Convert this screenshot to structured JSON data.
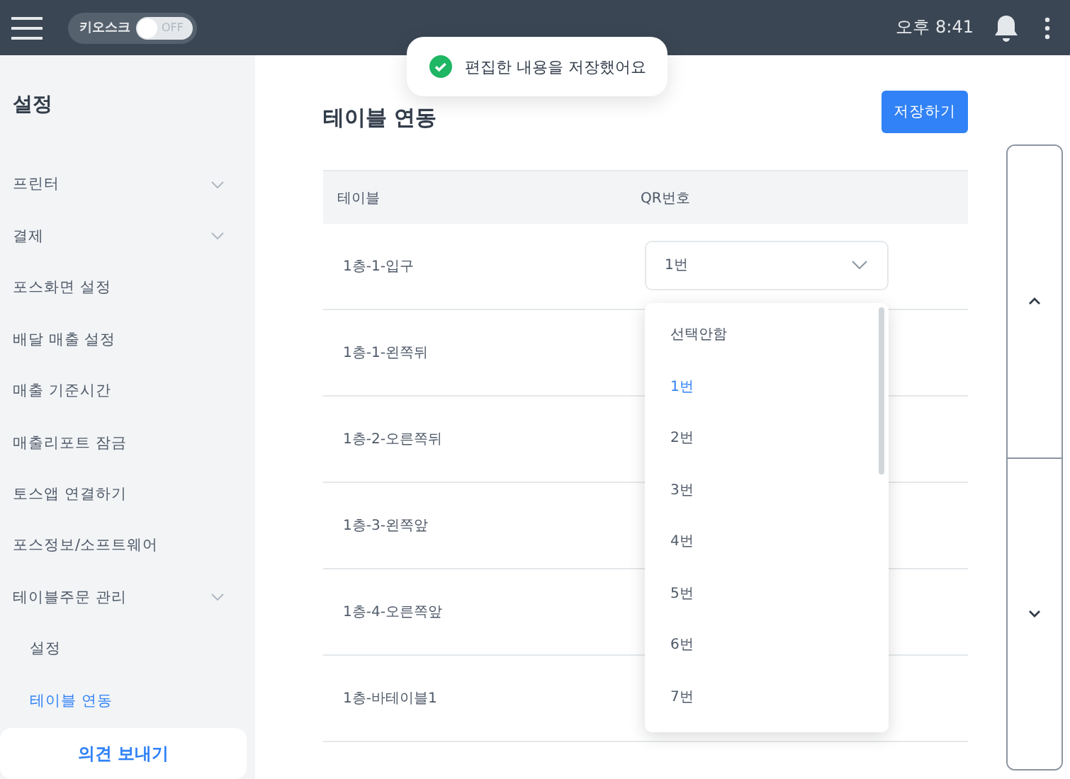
{
  "topbar": {
    "kiosk": {
      "label": "키오스크",
      "on": false,
      "state_label": "OFF"
    },
    "time": "오후 8:41"
  },
  "toast": {
    "message": "편집한 내용을 저장했어요"
  },
  "sidebar": {
    "title": "설정",
    "items": [
      {
        "label": "프린터",
        "kind": "group"
      },
      {
        "label": "결제",
        "kind": "group"
      },
      {
        "label": "포스화면 설정",
        "kind": "link"
      },
      {
        "label": "배달 매출 설정",
        "kind": "link"
      },
      {
        "label": "매출 기준시간",
        "kind": "link"
      },
      {
        "label": "매출리포트 잠금",
        "kind": "link"
      },
      {
        "label": "토스앱 연결하기",
        "kind": "link"
      },
      {
        "label": "포스정보/소프트웨어",
        "kind": "link"
      },
      {
        "label": "테이블주문 관리",
        "kind": "group",
        "children": [
          {
            "label": "설정",
            "selected": false
          },
          {
            "label": "테이블 연동",
            "selected": true
          }
        ]
      }
    ],
    "feedback_button": "의견 보내기"
  },
  "main": {
    "title": "테이블 연동",
    "save_button": "저장하기",
    "table": {
      "columns": [
        "테이블",
        "QR번호"
      ],
      "rows": [
        {
          "table": "1층-1-입구"
        },
        {
          "table": "1층-1-왼쪽뒤"
        },
        {
          "table": "1층-2-오른쪽뒤"
        },
        {
          "table": "1층-3-왼쪽앞"
        },
        {
          "table": "1층-4-오른쪽앞"
        },
        {
          "table": "1층-바테이블1"
        }
      ]
    },
    "qr_select": {
      "value": "1번",
      "options": [
        {
          "label": "선택안함",
          "selected": false
        },
        {
          "label": "1번",
          "selected": true
        },
        {
          "label": "2번",
          "selected": false
        },
        {
          "label": "3번",
          "selected": false
        },
        {
          "label": "4번",
          "selected": false
        },
        {
          "label": "5번",
          "selected": false
        },
        {
          "label": "6번",
          "selected": false
        },
        {
          "label": "7번",
          "selected": false
        }
      ]
    }
  }
}
